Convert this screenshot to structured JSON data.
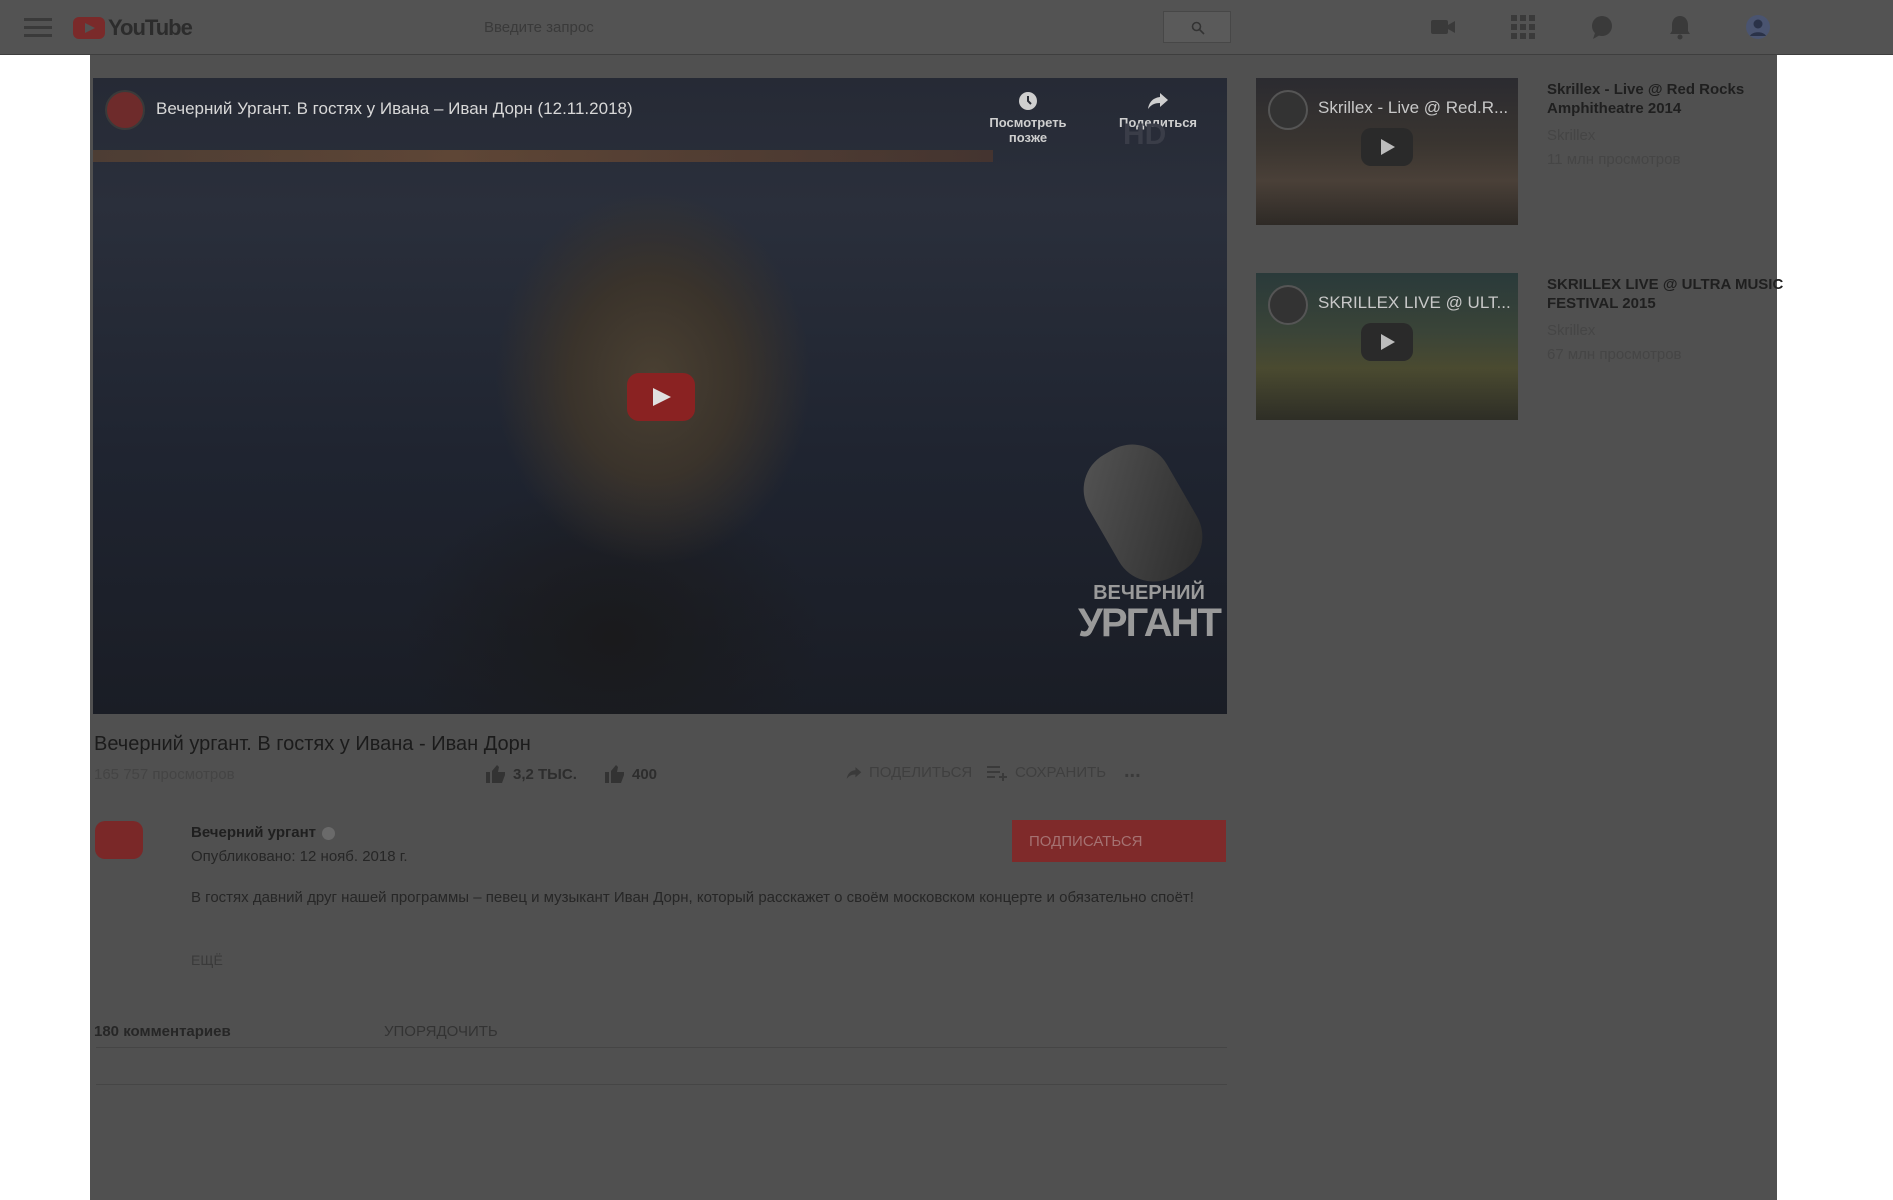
{
  "header": {
    "logo_text": "YouTube",
    "search_placeholder": "Введите запрос"
  },
  "player": {
    "title": "Вечерний Ургант. В гостях у Ивана – Иван Дорн (12.11.2018)",
    "watch_later_label": "Посмотреть позже",
    "share_label": "Поделиться",
    "watermark_line1": "ВЕЧЕРНИЙ",
    "watermark_line2": "УРГАНТ"
  },
  "video": {
    "title": "Вечерний ургант. В гостях у Ивана - Иван Дорн",
    "views": "165 757 просмотров",
    "likes": "3,2 ТЫС.",
    "dislikes": "400",
    "share_label": "ПОДЕЛИТЬСЯ",
    "save_label": "СОХРАНИТЬ",
    "more_actions": "..."
  },
  "owner": {
    "name": "Вечерний ургант",
    "published": "Опубликовано: 12 нояб. 2018 г.",
    "subscribe_label": "ПОДПИСАТЬСЯ",
    "description": "В гостях давний друг нашей программы – певец и музыкант Иван Дорн, который расскажет о своём московском концерте и обязательно споёт!",
    "more_label": "ЕЩЁ"
  },
  "comments": {
    "count_label": "180 комментариев",
    "sort_label": "УПОРЯДОЧИТЬ"
  },
  "related": [
    {
      "thumb_title": "Skrillex - Live @ Red.R...",
      "title": "Skrillex - Live @ Red Rocks Amphitheatre 2014",
      "channel": "Skrillex",
      "views": "11 млн просмотров"
    },
    {
      "thumb_title": "SKRILLEX LIVE @ ULT...",
      "title": "SKRILLEX LIVE @ ULTRA MUSIC FESTIVAL 2015",
      "channel": "Skrillex",
      "views": "67 млн просмотров"
    }
  ],
  "colors": {
    "overlay": "#505050",
    "subscribe": "#7f2a2a",
    "header": "#535353"
  }
}
